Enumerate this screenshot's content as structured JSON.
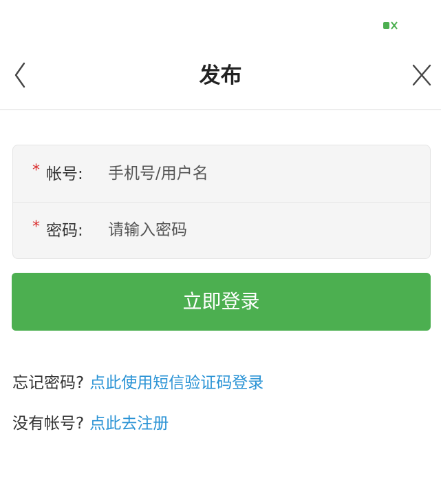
{
  "status_bar": {
    "indicator_icon": "battery-charging-icon",
    "accent_color": "#4caf50"
  },
  "header": {
    "title": "发布",
    "back_icon": "chevron-left-icon",
    "close_icon": "close-icon"
  },
  "form": {
    "account": {
      "required_mark": "*",
      "label": "帐号:",
      "placeholder": "手机号/用户名",
      "value": ""
    },
    "password": {
      "required_mark": "*",
      "label": "密码:",
      "placeholder": "请输入密码",
      "value": ""
    }
  },
  "login_button": {
    "label": "立即登录",
    "color": "#4caf50"
  },
  "links": {
    "forgot": {
      "prompt": "忘记密码?",
      "action": "点此使用短信验证码登录"
    },
    "register": {
      "prompt": "没有帐号?",
      "action": "点此去注册"
    },
    "link_color": "#2a93d5"
  }
}
